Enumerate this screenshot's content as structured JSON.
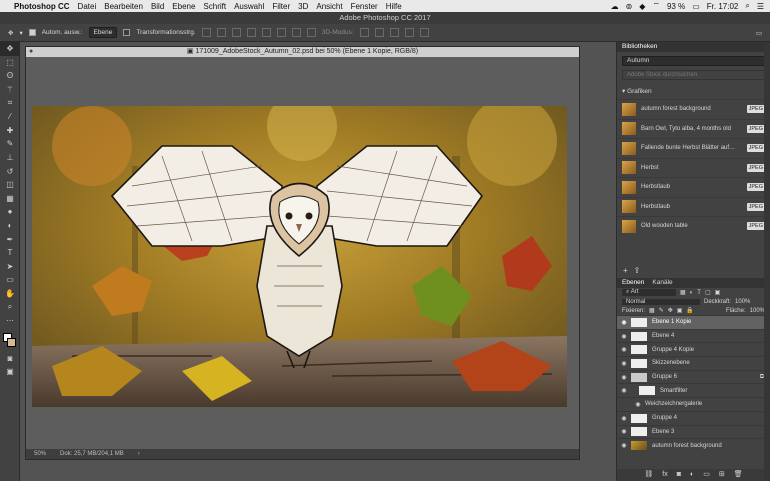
{
  "menubar": {
    "apple": "",
    "app": "Photoshop CC",
    "items": [
      "Datei",
      "Bearbeiten",
      "Bild",
      "Ebene",
      "Schrift",
      "Auswahl",
      "Filter",
      "3D",
      "Ansicht",
      "Fenster",
      "Hilfe"
    ],
    "battery": "93 %",
    "clock": "Fr. 17:02"
  },
  "window_title": "Adobe Photoshop CC 2017",
  "options_bar": {
    "auto_select": "Autom. ausw.:",
    "auto_select_value": "Ebene",
    "transform": "Transformationsstrg.",
    "mode3d": "3D-Modus:"
  },
  "document": {
    "tab_title": "171009_AdobeStock_Autumn_02.psd bei 50% (Ebene 1 Kopie, RGB/8)",
    "zoom": "50%",
    "doc_size": "Dok: 25,7 MB/204,1 MB"
  },
  "libraries": {
    "tab": "Bibliotheken",
    "selected": "Autumn",
    "search_placeholder": "Adobe Stock durchsuchen",
    "section": "Grafiken",
    "items": [
      {
        "name": "autumn forest background",
        "tag": "JPEG"
      },
      {
        "name": "Barn Owl, Tyto alba, 4 months old",
        "tag": "JPEG"
      },
      {
        "name": "Fallende bunte Herbst Blätter auf…",
        "tag": "JPEG"
      },
      {
        "name": "Herbst",
        "tag": "JPEG"
      },
      {
        "name": "Herbstlaub",
        "tag": "JPEG"
      },
      {
        "name": "Herbstlaub",
        "tag": "JPEG"
      },
      {
        "name": "Old wooden table",
        "tag": "JPEG"
      }
    ]
  },
  "layers_panel": {
    "tabs": [
      "Ebenen",
      "Kanäle"
    ],
    "filter": "Art",
    "blend_mode": "Normal",
    "opacity_label": "Deckkraft:",
    "opacity": "100%",
    "lock_label": "Fixieren:",
    "fill_label": "Fläche:",
    "fill": "100%",
    "layers": [
      {
        "name": "Ebene 1 Kopie",
        "selected": true
      },
      {
        "name": "Ebene 4"
      },
      {
        "name": "Gruppe 4 Kopie"
      },
      {
        "name": "Skizzenebene"
      },
      {
        "name": "Gruppe 6"
      },
      {
        "name": "Smartfilter"
      },
      {
        "name": "Weichzeichnergalerie"
      },
      {
        "name": "Gruppe 4"
      },
      {
        "name": "Ebene 3"
      },
      {
        "name": "autumn forest background"
      }
    ]
  }
}
